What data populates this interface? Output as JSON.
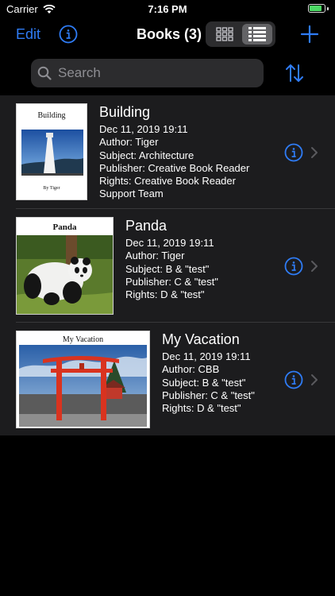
{
  "status": {
    "carrier": "Carrier",
    "time": "7:16 PM",
    "battery_level": 0.82
  },
  "nav": {
    "edit_label": "Edit",
    "title": "Books (3)",
    "view_mode": "list"
  },
  "search": {
    "placeholder": "Search",
    "value": ""
  },
  "colors": {
    "accent": "#2f7cf6",
    "background": "#000000",
    "row_bg": "#1c1c1e",
    "battery": "#4cd964"
  },
  "icons": [
    "wifi-icon",
    "info-icon",
    "grid-view-icon",
    "list-view-icon",
    "plus-icon",
    "search-icon",
    "sort-icon",
    "chevron-right-icon"
  ],
  "books": [
    {
      "title": "Building",
      "date": "Dec 11, 2019 19:11",
      "author": "Author: Tiger",
      "subject": "Subject: Architecture",
      "publisher": "Publisher: Creative Book Reader",
      "rights": "Rights: Creative Book Reader",
      "rights_cont": "Support Team",
      "cover": {
        "title": "Building",
        "byline": "By Tiger"
      }
    },
    {
      "title": "Panda",
      "date": "Dec 11, 2019 19:11",
      "author": "Author: Tiger",
      "subject": "Subject: B & \"test\"",
      "publisher": "Publisher: C & \"test\"",
      "rights": "Rights: D & \"test\"",
      "cover": {
        "title": "Panda"
      }
    },
    {
      "title": "My Vacation",
      "date": "Dec 11, 2019 19:11",
      "author": "Author: CBB",
      "subject": "Subject: B & \"test\"",
      "publisher": "Publisher: C & \"test\"",
      "rights": "Rights: D & \"test\"",
      "cover": {
        "title": "My Vacation"
      }
    }
  ]
}
